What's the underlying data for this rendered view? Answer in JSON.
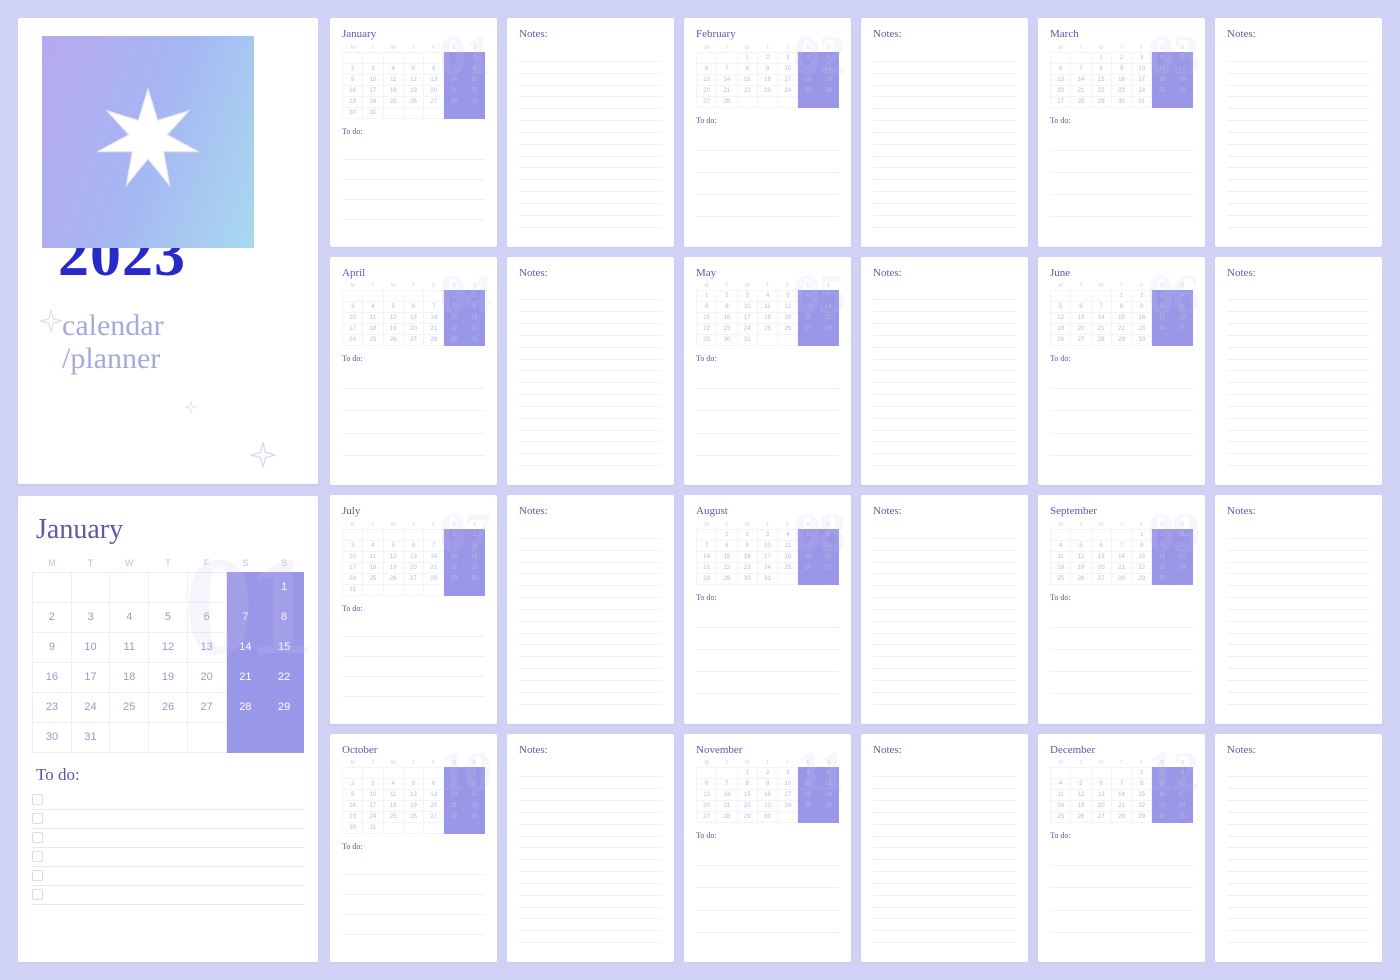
{
  "cover": {
    "year": "2023",
    "subtitle1": "calendar",
    "subtitle2": "/planner"
  },
  "labels": {
    "todo": "To do:",
    "notes": "Notes:"
  },
  "weekdays": [
    "M",
    "T",
    "W",
    "T",
    "F",
    "S",
    "S"
  ],
  "feature_month": {
    "name": "January",
    "bgnum": "01",
    "weeks": [
      [
        "",
        "",
        "",
        "",
        "",
        "",
        1
      ],
      [
        2,
        3,
        4,
        5,
        6,
        7,
        8
      ],
      [
        9,
        10,
        11,
        12,
        13,
        14,
        15
      ],
      [
        16,
        17,
        18,
        19,
        20,
        21,
        22
      ],
      [
        23,
        24,
        25,
        26,
        27,
        28,
        29
      ],
      [
        30,
        31,
        "",
        "",
        "",
        "",
        ""
      ]
    ]
  },
  "months": [
    {
      "name": "January",
      "bgnum": "01",
      "weeks": [
        [
          "",
          "",
          "",
          "",
          "",
          "",
          1
        ],
        [
          2,
          3,
          4,
          5,
          6,
          7,
          8
        ],
        [
          9,
          10,
          11,
          12,
          13,
          14,
          15
        ],
        [
          16,
          17,
          18,
          19,
          20,
          21,
          22
        ],
        [
          23,
          24,
          25,
          26,
          27,
          28,
          29
        ],
        [
          30,
          31,
          "",
          "",
          "",
          "",
          ""
        ]
      ]
    },
    {
      "name": "February",
      "bgnum": "02",
      "weeks": [
        [
          "",
          "",
          1,
          2,
          3,
          4,
          5
        ],
        [
          6,
          7,
          8,
          9,
          10,
          11,
          12
        ],
        [
          13,
          14,
          15,
          16,
          17,
          18,
          19
        ],
        [
          20,
          21,
          22,
          23,
          24,
          25,
          26
        ],
        [
          27,
          28,
          "",
          "",
          "",
          "",
          ""
        ]
      ]
    },
    {
      "name": "March",
      "bgnum": "03",
      "weeks": [
        [
          "",
          "",
          1,
          2,
          3,
          4,
          5
        ],
        [
          6,
          7,
          8,
          9,
          10,
          11,
          12
        ],
        [
          13,
          14,
          15,
          16,
          17,
          18,
          19
        ],
        [
          20,
          21,
          22,
          23,
          24,
          25,
          26
        ],
        [
          27,
          28,
          29,
          30,
          31,
          "",
          ""
        ]
      ]
    },
    {
      "name": "April",
      "bgnum": "04",
      "weeks": [
        [
          "",
          "",
          "",
          "",
          "",
          1,
          2
        ],
        [
          3,
          4,
          5,
          6,
          7,
          8,
          9
        ],
        [
          10,
          11,
          12,
          13,
          14,
          15,
          16
        ],
        [
          17,
          18,
          19,
          20,
          21,
          22,
          23
        ],
        [
          24,
          25,
          26,
          27,
          28,
          29,
          30
        ]
      ]
    },
    {
      "name": "May",
      "bgnum": "05",
      "weeks": [
        [
          1,
          2,
          3,
          4,
          5,
          6,
          7
        ],
        [
          8,
          9,
          10,
          11,
          12,
          13,
          14
        ],
        [
          15,
          16,
          17,
          18,
          19,
          20,
          21
        ],
        [
          22,
          23,
          24,
          25,
          26,
          27,
          28
        ],
        [
          29,
          30,
          31,
          "",
          "",
          "",
          ""
        ]
      ]
    },
    {
      "name": "June",
      "bgnum": "06",
      "weeks": [
        [
          "",
          "",
          "",
          1,
          2,
          3,
          4
        ],
        [
          5,
          6,
          7,
          8,
          9,
          10,
          11
        ],
        [
          12,
          13,
          14,
          15,
          16,
          17,
          18
        ],
        [
          19,
          20,
          21,
          22,
          23,
          24,
          25
        ],
        [
          26,
          27,
          28,
          29,
          30,
          "",
          ""
        ]
      ]
    },
    {
      "name": "July",
      "bgnum": "07",
      "weeks": [
        [
          "",
          "",
          "",
          "",
          "",
          1,
          2
        ],
        [
          3,
          4,
          5,
          6,
          7,
          8,
          9
        ],
        [
          10,
          11,
          12,
          13,
          14,
          15,
          16
        ],
        [
          17,
          18,
          19,
          20,
          21,
          22,
          23
        ],
        [
          24,
          25,
          26,
          27,
          28,
          29,
          30
        ],
        [
          31,
          "",
          "",
          "",
          "",
          "",
          ""
        ]
      ]
    },
    {
      "name": "August",
      "bgnum": "08",
      "weeks": [
        [
          "",
          1,
          2,
          3,
          4,
          5,
          6
        ],
        [
          7,
          8,
          9,
          10,
          11,
          12,
          13
        ],
        [
          14,
          15,
          16,
          17,
          18,
          19,
          20
        ],
        [
          21,
          22,
          23,
          24,
          25,
          26,
          27
        ],
        [
          28,
          29,
          30,
          31,
          "",
          "",
          ""
        ]
      ]
    },
    {
      "name": "September",
      "bgnum": "09",
      "weeks": [
        [
          "",
          "",
          "",
          "",
          1,
          2,
          3
        ],
        [
          4,
          5,
          6,
          7,
          8,
          9,
          10
        ],
        [
          11,
          12,
          13,
          14,
          15,
          16,
          17
        ],
        [
          18,
          19,
          20,
          21,
          22,
          23,
          24
        ],
        [
          25,
          26,
          27,
          28,
          29,
          30,
          ""
        ]
      ]
    },
    {
      "name": "October",
      "bgnum": "10",
      "weeks": [
        [
          "",
          "",
          "",
          "",
          "",
          "",
          1
        ],
        [
          2,
          3,
          4,
          5,
          6,
          7,
          8
        ],
        [
          9,
          10,
          11,
          12,
          13,
          14,
          15
        ],
        [
          16,
          17,
          18,
          19,
          20,
          21,
          22
        ],
        [
          23,
          24,
          25,
          26,
          27,
          28,
          29
        ],
        [
          30,
          31,
          "",
          "",
          "",
          "",
          ""
        ]
      ]
    },
    {
      "name": "November",
      "bgnum": "11",
      "weeks": [
        [
          "",
          "",
          1,
          2,
          3,
          4,
          5
        ],
        [
          6,
          7,
          8,
          9,
          10,
          11,
          12
        ],
        [
          13,
          14,
          15,
          16,
          17,
          18,
          19
        ],
        [
          20,
          21,
          22,
          23,
          24,
          25,
          26
        ],
        [
          27,
          28,
          29,
          30,
          "",
          "",
          ""
        ]
      ]
    },
    {
      "name": "December",
      "bgnum": "12",
      "weeks": [
        [
          "",
          "",
          "",
          "",
          1,
          2,
          3
        ],
        [
          4,
          5,
          6,
          7,
          8,
          9,
          10
        ],
        [
          11,
          12,
          13,
          14,
          15,
          16,
          17
        ],
        [
          18,
          19,
          20,
          21,
          22,
          23,
          24
        ],
        [
          25,
          26,
          27,
          28,
          29,
          30,
          31
        ]
      ]
    }
  ],
  "colors": {
    "accent": "#9a97e8",
    "text": "#5a5aa8",
    "yearBlue": "#2929c9"
  }
}
